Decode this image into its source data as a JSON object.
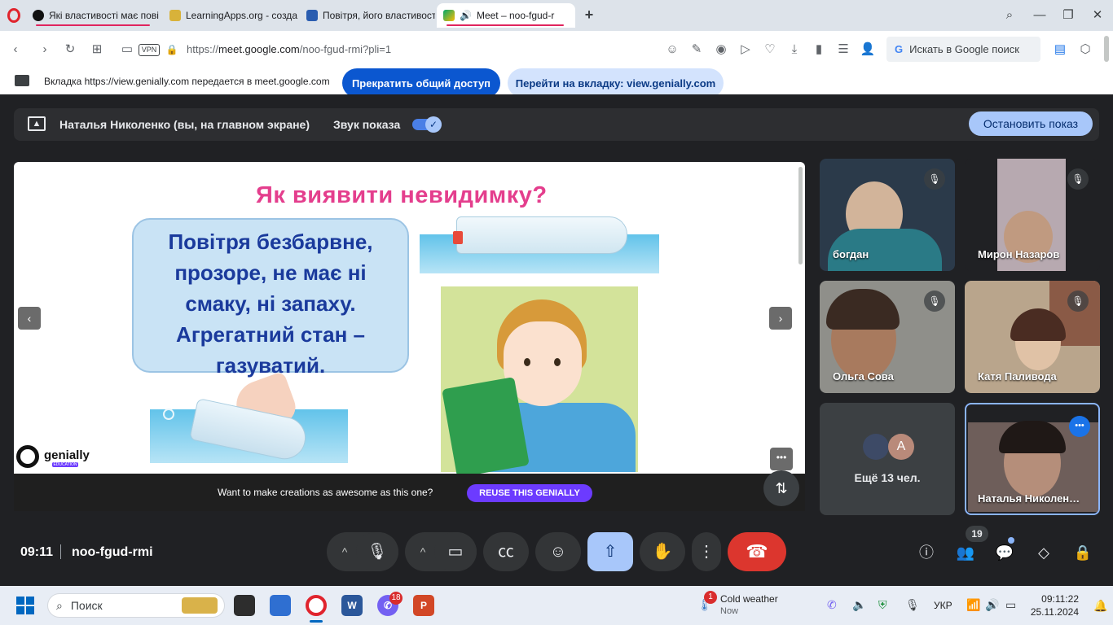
{
  "browser": {
    "tabs": [
      {
        "label": "Які властивості має пові",
        "favicon_color": "#111111"
      },
      {
        "label": "LearningApps.org - созда",
        "favicon_color": "#d8b23a"
      },
      {
        "label": "Повітря, його властивост",
        "favicon_color": "#2a5db0"
      },
      {
        "label": "Meet – noo-fgud-r",
        "favicon_color": "#00a86b"
      }
    ],
    "new_tab_label": "+",
    "url_prefix": "https://",
    "url_host": "meet.google.com",
    "url_path": "/noo-fgud-rmi?pli=1",
    "vpn_badge": "VPN",
    "search_label": "Искать в Google поиск"
  },
  "share_banner": {
    "text": "Вкладка https://view.genially.com передается в meet.google.com",
    "stop_button": "Прекратить общий доступ",
    "go_button": "Перейти на вкладку: view.genially.com"
  },
  "presenting": {
    "name": "Наталья Николенко (вы, на главном экране)",
    "sound_label": "Звук показа",
    "stop_button": "Остановить показ"
  },
  "slide": {
    "title": "Як виявити невидимку?",
    "bubble_lines": [
      "Повітря безбарвне,",
      "прозоре, не має ні",
      "смаку, ні запаху.",
      "Агрегатний стан –",
      "газуватий."
    ],
    "brand": "genially",
    "brand_sub": "EDUCATION",
    "reuse_text": "Want to make creations as awesome as this one?",
    "reuse_button": "REUSE THIS GENIALLY",
    "prev_label": "‹",
    "next_label": "›",
    "more_label": "•••"
  },
  "participants": [
    {
      "name": "богдан",
      "muted": true,
      "bg": "#2b3a4a"
    },
    {
      "name": "Мирон Назаров",
      "muted": true,
      "bg": "#b7a9b0"
    },
    {
      "name": "Ольга Сова",
      "muted": true,
      "bg": "#8f8f8a"
    },
    {
      "name": "Катя Паливода",
      "muted": true,
      "bg": "#b9a58c"
    },
    {
      "name": "Наталья Николен…",
      "muted": false,
      "bg": "#6e5e5a"
    }
  ],
  "more_participants": {
    "label": "Ещё 13 чел.",
    "avatar_letter": "A"
  },
  "bottom": {
    "time": "09:11",
    "meeting_code": "noo-fgud-rmi",
    "participant_count": "19"
  },
  "taskbar": {
    "search_label": "Поиск",
    "viber_badge": "18",
    "weather_title": "Cold weather",
    "weather_sub": "Now",
    "weather_badge": "1",
    "language": "УКР",
    "time": "09:11:22",
    "date": "25.11.2024"
  },
  "colors": {
    "accent_blue": "#0b57d0",
    "end_call_red": "#dc362e",
    "slide_title_pink": "#e43e8d",
    "genially_purple": "#6c3bff"
  }
}
